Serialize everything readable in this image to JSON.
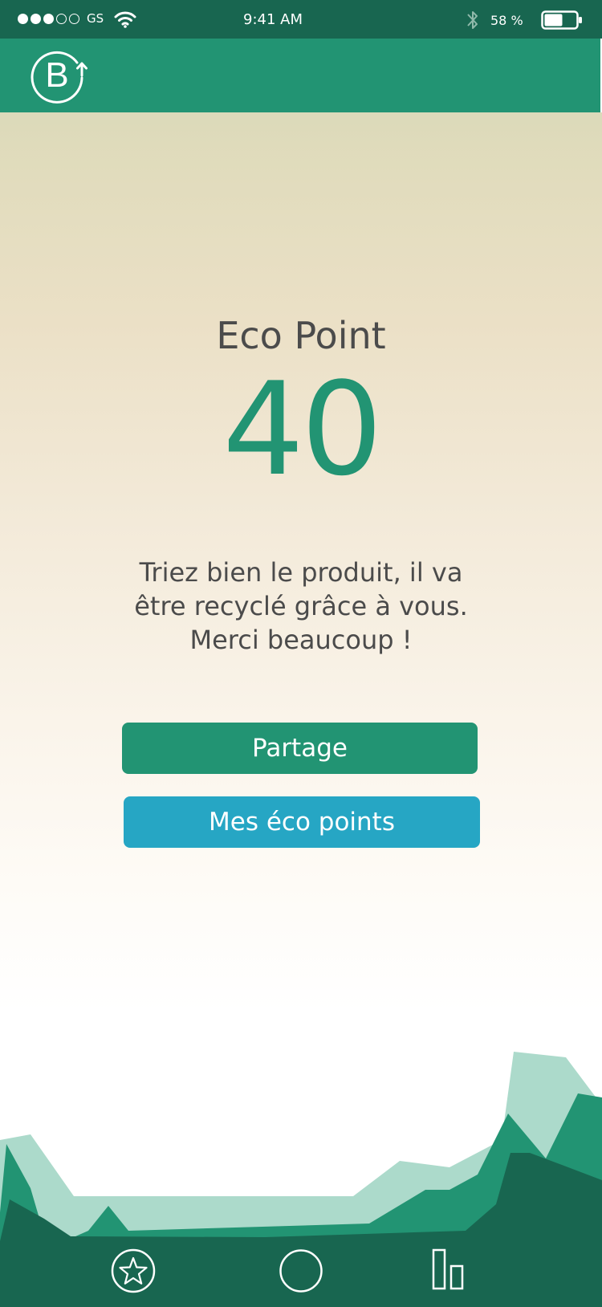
{
  "status_bar": {
    "signal_filled": 3,
    "signal_total": 5,
    "carrier": "GS",
    "time": "9:41 AM",
    "battery_percent": "58 %",
    "battery_level": 0.58
  },
  "header": {
    "logo_letter": "B",
    "color": "#229473"
  },
  "main": {
    "title": "Eco Point",
    "points": "40",
    "message": "Triez bien le produit, il va\nêtre recyclé grâce à vous.\nMerci beaucoup !"
  },
  "buttons": {
    "share_label": "Partage",
    "eco_points_label": "Mes éco points"
  },
  "bottom_nav": {
    "items": [
      "star-icon",
      "circle-icon",
      "stats-icon"
    ]
  },
  "colors": {
    "primary_green": "#229473",
    "dark_green": "#186650",
    "light_green": "#acdacb",
    "accent_blue": "#26a6c4",
    "text_gray": "#4b4b4b"
  }
}
